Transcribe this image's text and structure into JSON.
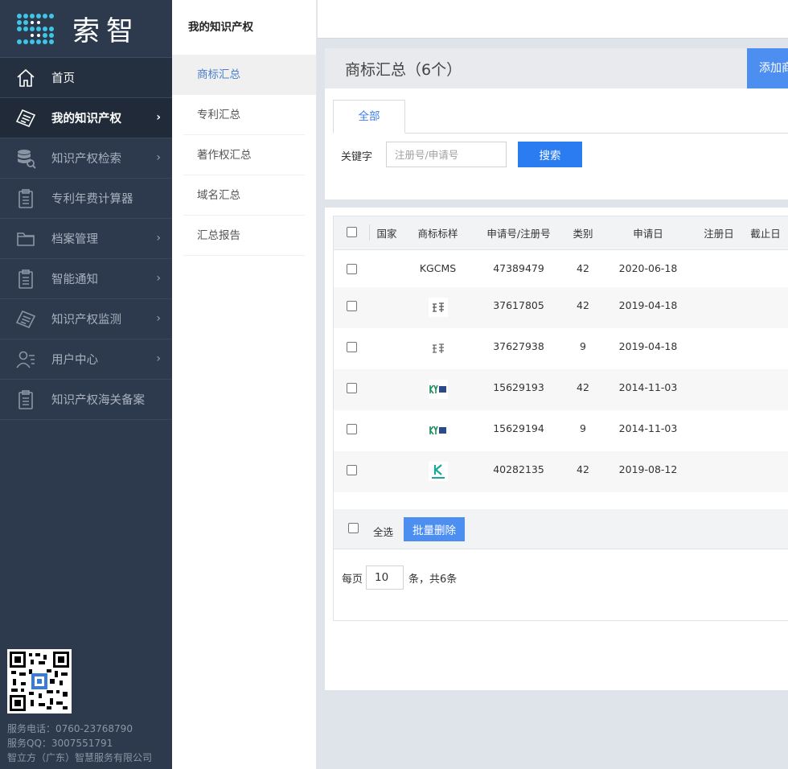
{
  "brand": {
    "name": "索智"
  },
  "sidebar": {
    "items": [
      {
        "label": "首页",
        "icon": "home-icon",
        "has_arrow": false
      },
      {
        "label": "我的知识产权",
        "icon": "certificate-icon",
        "has_arrow": true
      },
      {
        "label": "知识产权检索",
        "icon": "database-search-icon",
        "has_arrow": true
      },
      {
        "label": "专利年费计算器",
        "icon": "clipboard-icon",
        "has_arrow": false
      },
      {
        "label": "档案管理",
        "icon": "folder-icon",
        "has_arrow": true
      },
      {
        "label": "智能通知",
        "icon": "clipboard-icon",
        "has_arrow": true
      },
      {
        "label": "知识产权监测",
        "icon": "certificate-icon",
        "has_arrow": true
      },
      {
        "label": "用户中心",
        "icon": "user-list-icon",
        "has_arrow": true
      },
      {
        "label": "知识产权海关备案",
        "icon": "clipboard-icon",
        "has_arrow": false
      }
    ],
    "contact": {
      "phone": "服务电话：0760-23768790",
      "qq": "服务QQ：3007551791",
      "company": "智立方（广东）智慧服务有限公司"
    }
  },
  "submenu": {
    "title": "我的知识产权",
    "items": [
      "商标汇总",
      "专利汇总",
      "著作权汇总",
      "域名汇总",
      "汇总报告"
    ]
  },
  "main": {
    "title": "商标汇总（6个）",
    "add_button": "添加商标",
    "tab_all": "全部",
    "keyword_label": "关键字",
    "keyword_placeholder": "注册号/申请号",
    "search_button": "搜索",
    "columns": [
      "国家",
      "商标标样",
      "申请号/注册号",
      "类别",
      "申请日",
      "注册日",
      "截止日"
    ],
    "rows": [
      {
        "country": "",
        "sample_text": "KGCMS",
        "sample_icon": "",
        "app_no": "47389479",
        "class": "42",
        "app_date": "2020-06-18",
        "reg_date": "",
        "end_date": ""
      },
      {
        "country": "",
        "sample_text": "",
        "sample_icon": "suozhi-logo-icon",
        "app_no": "37617805",
        "class": "42",
        "app_date": "2019-04-18",
        "reg_date": "",
        "end_date": ""
      },
      {
        "country": "",
        "sample_text": "",
        "sample_icon": "suozhi-logo-icon",
        "app_no": "37627938",
        "class": "9",
        "app_date": "2019-04-18",
        "reg_date": "",
        "end_date": ""
      },
      {
        "country": "",
        "sample_text": "",
        "sample_icon": "kyg-logo-icon",
        "app_no": "15629193",
        "class": "42",
        "app_date": "2014-11-03",
        "reg_date": "",
        "end_date": ""
      },
      {
        "country": "",
        "sample_text": "",
        "sample_icon": "kyg-logo-icon",
        "app_no": "15629194",
        "class": "9",
        "app_date": "2014-11-03",
        "reg_date": "",
        "end_date": ""
      },
      {
        "country": "",
        "sample_text": "",
        "sample_icon": "kgcms-logo-icon",
        "app_no": "40282135",
        "class": "42",
        "app_date": "2019-08-12",
        "reg_date": "",
        "end_date": ""
      }
    ],
    "select_all": "全选",
    "bulk_delete": "批量删除",
    "pager": {
      "prefix": "每页",
      "page_size": "10",
      "suffix": "条，共6条"
    }
  },
  "colors": {
    "sidebar_bg": "#2d3a4e",
    "accent": "#2b7cf0",
    "button": "#4d8ff0",
    "link": "#4a7fc9"
  }
}
